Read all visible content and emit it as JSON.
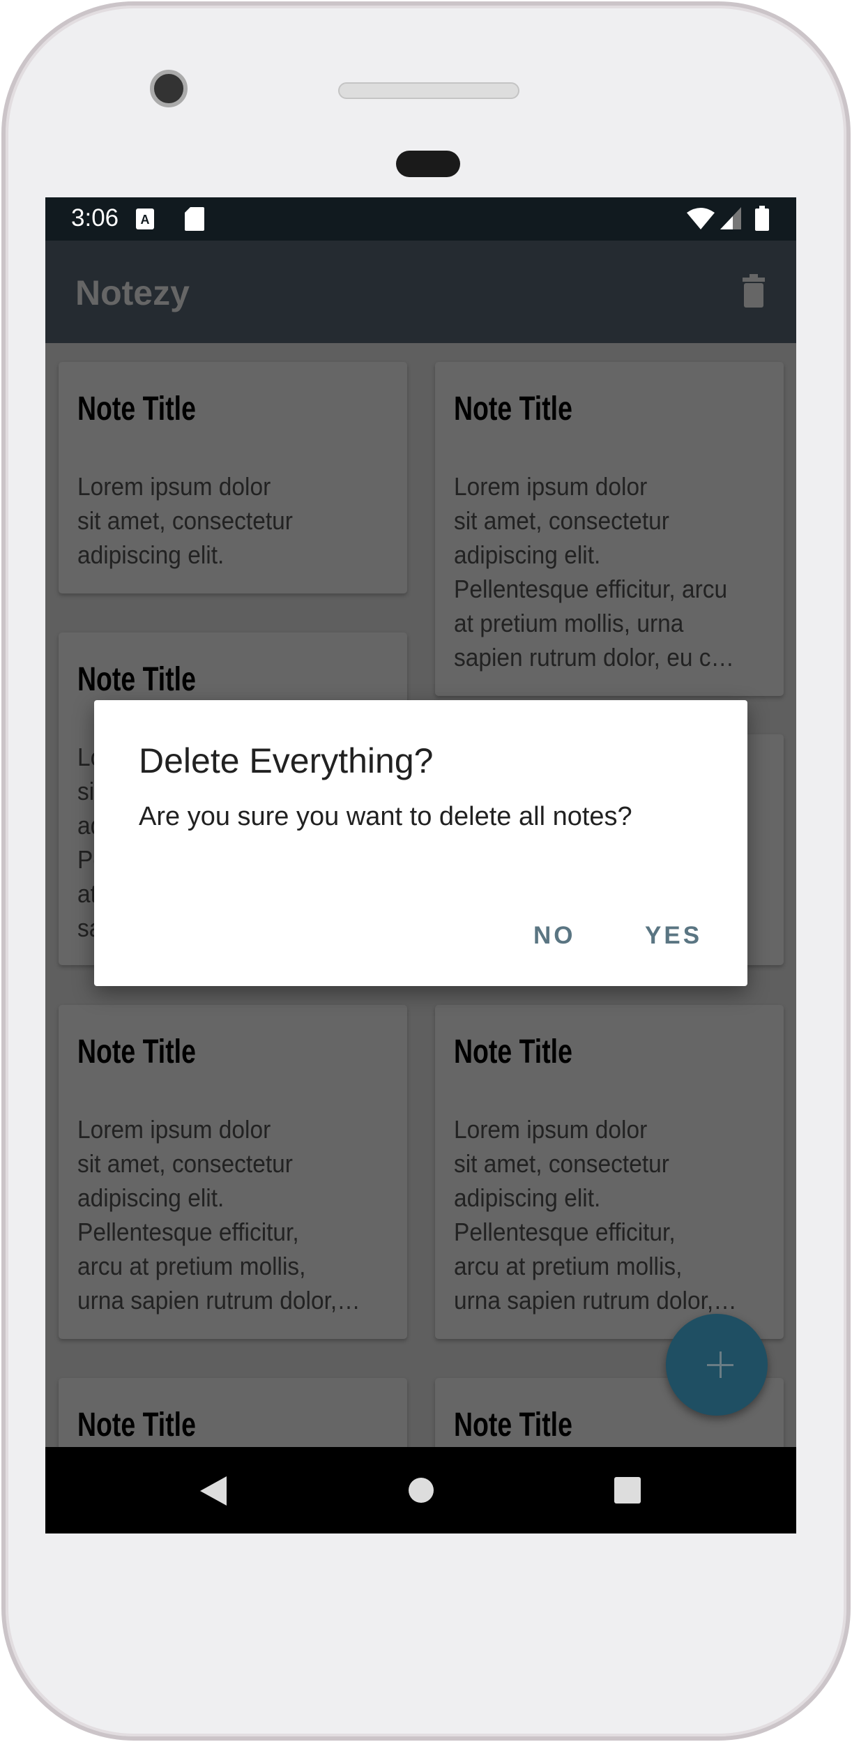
{
  "status_bar": {
    "time": "3:06",
    "icons": [
      "a-notification-icon",
      "sd-card-icon",
      "wifi-icon",
      "signal-icon",
      "battery-icon"
    ]
  },
  "app_bar": {
    "title": "Notezy",
    "action_icon": "trash-icon"
  },
  "notes": [
    {
      "title": "Note Title",
      "lines": [
        "Lorem ipsum dolor",
        "sit amet, consectetur",
        "adipiscing elit."
      ]
    },
    {
      "title": "Note Title",
      "lines": [
        "Lorem ipsum dolor",
        "sit amet, consectetur",
        "adipiscing elit.",
        "Pellentesque efficitur, arcu",
        "at pretium mollis, urna",
        "sapien rutrum dolor, eu c…"
      ]
    },
    {
      "title": "Note Title",
      "lines": [
        "Lorem ipsum dolor",
        "sit amet, consectetur",
        "adipiscing elit.",
        "Pellentesque efficitur, arcu",
        "at pretium mollis, urna",
        "sapien rutrum dolor, eu c…"
      ]
    },
    {
      "title": "",
      "lines": []
    },
    {
      "title": "Note Title",
      "lines": [
        "Lorem ipsum dolor",
        "sit amet, consectetur",
        "adipiscing elit.",
        "Pellentesque efficitur,",
        "arcu at pretium mollis,",
        "urna sapien rutrum dolor,…"
      ]
    },
    {
      "title": "Note Title",
      "lines": [
        "Lorem ipsum dolor",
        "sit amet, consectetur",
        "adipiscing elit.",
        "Pellentesque efficitur,",
        "arcu at pretium mollis,",
        "urna sapien rutrum dolor,…"
      ]
    },
    {
      "title": "Note Title",
      "lines": []
    },
    {
      "title": "Note Title",
      "lines": []
    }
  ],
  "fab": {
    "icon": "plus-icon",
    "color": "#1f4f63"
  },
  "dialog": {
    "title": "Delete Everything?",
    "message": "Are you sure you want to delete all notes?",
    "no_label": "NO",
    "yes_label": "YES",
    "button_color": "#5a7582"
  },
  "nav_bar": {
    "icons": [
      "back-icon",
      "home-icon",
      "recents-icon"
    ]
  }
}
